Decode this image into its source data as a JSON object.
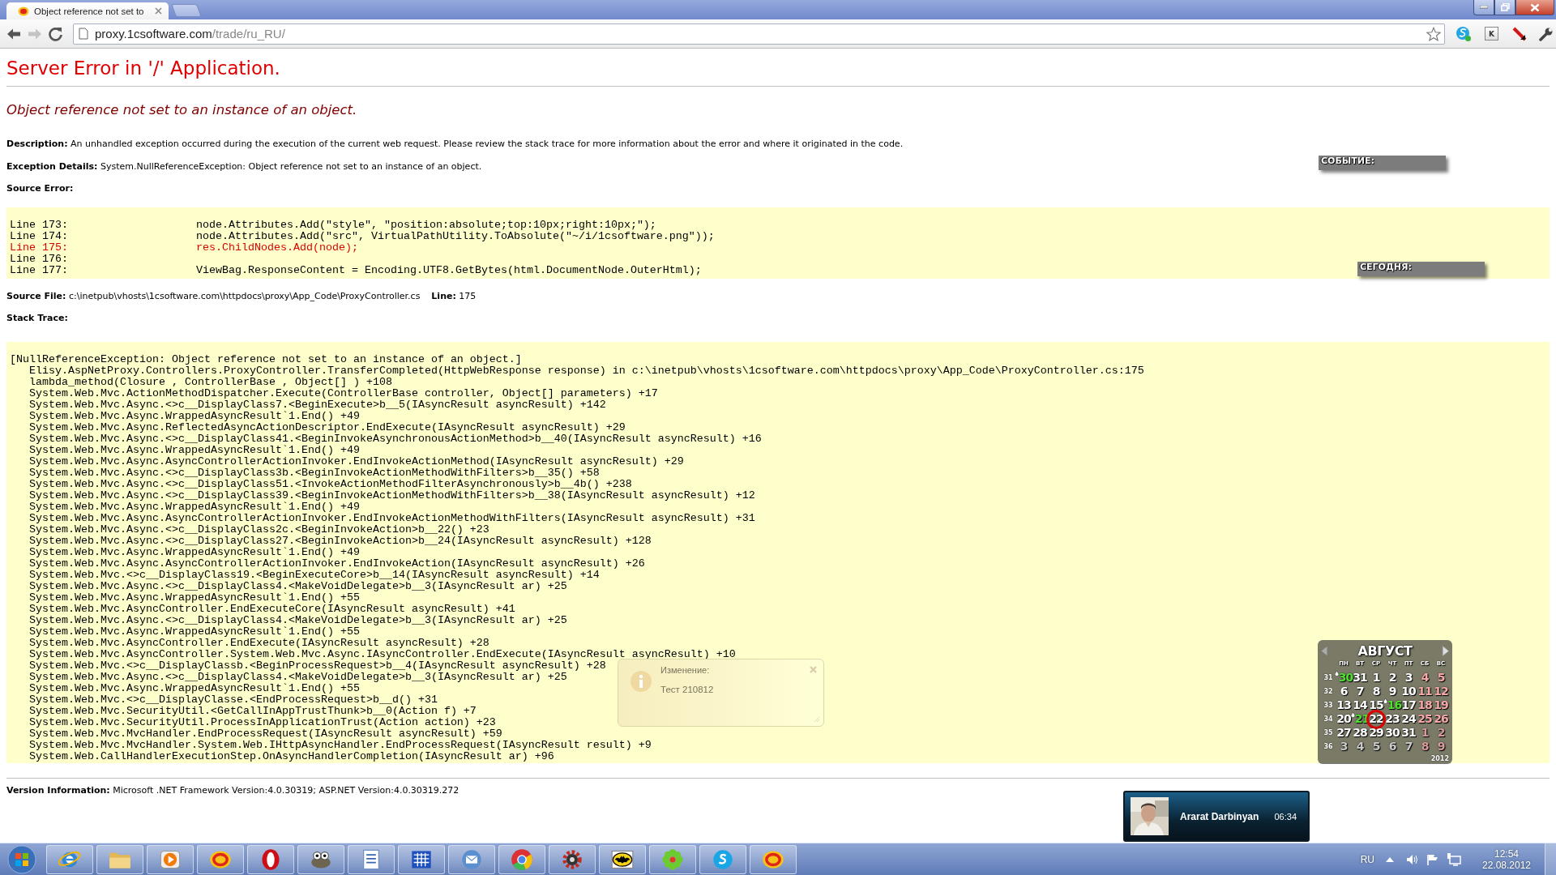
{
  "browser": {
    "tab": {
      "title": "Object reference not set to",
      "selected": true
    },
    "url": {
      "host": "proxy.1csoftware.com",
      "path": "/trade/ru_RU/"
    },
    "extension_key_label": "K"
  },
  "page": {
    "title": "Server Error in '/' Application.",
    "message": "Object reference not set to an instance of an object.",
    "description": {
      "label": "Description:",
      "text": "An unhandled exception occurred during the execution of the current web request. Please review the stack trace for more information about the error and where it originated in the code."
    },
    "exception_details": {
      "label": "Exception Details:",
      "text": "System.NullReferenceException: Object reference not set to an instance of an object."
    },
    "source_error_label": "Source Error:",
    "source_lines": [
      {
        "label": "Line 173:",
        "code": "node.Attributes.Add(\"style\", \"position:absolute;top:10px;right:10px;\");",
        "error": false
      },
      {
        "label": "Line 174:",
        "code": "node.Attributes.Add(\"src\", VirtualPathUtility.ToAbsolute(\"~/i/1csoftware.png\"));",
        "error": false
      },
      {
        "label": "Line 175:",
        "code": "res.ChildNodes.Add(node);",
        "error": true
      },
      {
        "label": "Line 176:",
        "error": false
      },
      {
        "label": "Line 177:",
        "code": "ViewBag.ResponseContent = Encoding.UTF8.GetBytes(html.DocumentNode.OuterHtml);",
        "error": false
      }
    ],
    "source_file": {
      "label": "Source File:",
      "path": "c:\\inetpub\\vhosts\\1csoftware.com\\httpdocs\\proxy\\App_Code\\ProxyController.cs",
      "line_label": "Line:",
      "line": "175"
    },
    "stack_trace_label": "Stack Trace:",
    "stack_trace": [
      "[NullReferenceException: Object reference not set to an instance of an object.]",
      "   Elisy.AspNetProxy.Controllers.ProxyController.TransferCompleted(HttpWebResponse response) in c:\\inetpub\\vhosts\\1csoftware.com\\httpdocs\\proxy\\App_Code\\ProxyController.cs:175",
      "   lambda_method(Closure , ControllerBase , Object[] ) +108",
      "   System.Web.Mvc.ActionMethodDispatcher.Execute(ControllerBase controller, Object[] parameters) +17",
      "   System.Web.Mvc.Async.<>c__DisplayClass7.<BeginExecute>b__5(IAsyncResult asyncResult) +142",
      "   System.Web.Mvc.Async.WrappedAsyncResult`1.End() +49",
      "   System.Web.Mvc.Async.ReflectedAsyncActionDescriptor.EndExecute(IAsyncResult asyncResult) +29",
      "   System.Web.Mvc.Async.<>c__DisplayClass41.<BeginInvokeAsynchronousActionMethod>b__40(IAsyncResult asyncResult) +16",
      "   System.Web.Mvc.Async.WrappedAsyncResult`1.End() +49",
      "   System.Web.Mvc.Async.AsyncControllerActionInvoker.EndInvokeActionMethod(IAsyncResult asyncResult) +29",
      "   System.Web.Mvc.Async.<>c__DisplayClass3b.<BeginInvokeActionMethodWithFilters>b__35() +58",
      "   System.Web.Mvc.Async.<>c__DisplayClass51.<InvokeActionMethodFilterAsynchronously>b__4b() +238",
      "   System.Web.Mvc.Async.<>c__DisplayClass39.<BeginInvokeActionMethodWithFilters>b__38(IAsyncResult asyncResult) +12",
      "   System.Web.Mvc.Async.WrappedAsyncResult`1.End() +49",
      "   System.Web.Mvc.Async.AsyncControllerActionInvoker.EndInvokeActionMethodWithFilters(IAsyncResult asyncResult) +31",
      "   System.Web.Mvc.Async.<>c__DisplayClass2c.<BeginInvokeAction>b__22() +23",
      "   System.Web.Mvc.Async.<>c__DisplayClass27.<BeginInvokeAction>b__24(IAsyncResult asyncResult) +128",
      "   System.Web.Mvc.Async.WrappedAsyncResult`1.End() +49",
      "   System.Web.Mvc.Async.AsyncControllerActionInvoker.EndInvokeAction(IAsyncResult asyncResult) +26",
      "   System.Web.Mvc.<>c__DisplayClass19.<BeginExecuteCore>b__14(IAsyncResult asyncResult) +14",
      "   System.Web.Mvc.Async.<>c__DisplayClass4.<MakeVoidDelegate>b__3(IAsyncResult ar) +25",
      "   System.Web.Mvc.Async.WrappedAsyncResult`1.End() +55",
      "   System.Web.Mvc.AsyncController.EndExecuteCore(IAsyncResult asyncResult) +41",
      "   System.Web.Mvc.Async.<>c__DisplayClass4.<MakeVoidDelegate>b__3(IAsyncResult ar) +25",
      "   System.Web.Mvc.Async.WrappedAsyncResult`1.End() +55",
      "   System.Web.Mvc.AsyncController.EndExecute(IAsyncResult asyncResult) +28",
      "   System.Web.Mvc.AsyncController.System.Web.Mvc.Async.IAsyncController.EndExecute(IAsyncResult asyncResult) +10",
      "   System.Web.Mvc.<>c__DisplayClassb.<BeginProcessRequest>b__4(IAsyncResult asyncResult) +28",
      "   System.Web.Mvc.Async.<>c__DisplayClass4.<MakeVoidDelegate>b__3(IAsyncResult ar) +25",
      "   System.Web.Mvc.Async.WrappedAsyncResult`1.End() +55",
      "   System.Web.Mvc.<>c__DisplayClasse.<EndProcessRequest>b__d() +31",
      "   System.Web.Mvc.SecurityUtil.<GetCallInAppTrustThunk>b__0(Action f) +7",
      "   System.Web.Mvc.SecurityUtil.ProcessInApplicationTrust(Action action) +23",
      "   System.Web.Mvc.MvcHandler.EndProcessRequest(IAsyncResult asyncResult) +59",
      "   System.Web.Mvc.MvcHandler.System.Web.IHttpAsyncHandler.EndProcessRequest(IAsyncResult result) +9",
      "   System.Web.CallHandlerExecutionStep.OnAsyncHandlerCompletion(IAsyncResult ar) +96"
    ],
    "version": {
      "label": "Version Information:",
      "text": "Microsoft .NET Framework Version:4.0.30319; ASP.NET Version:4.0.30319.272"
    }
  },
  "gadgets": {
    "event_label": "СОБЫТИЕ:",
    "today_label": "СЕГОДНЯ:",
    "calendar": {
      "month": "АВГУСТ",
      "year": "2012",
      "weekdays": [
        "ПН",
        "ВТ",
        "СР",
        "ЧТ",
        "ПТ",
        "СБ",
        "ВС"
      ],
      "weeks": [
        {
          "number": "31",
          "days": [
            {
              "day": "30",
              "kind": "event",
              "today": false
            },
            {
              "day": "31",
              "kind": "weekday",
              "today": false
            },
            {
              "day": "1",
              "kind": "weekday",
              "today": false
            },
            {
              "day": "2",
              "kind": "weekday",
              "today": false
            },
            {
              "day": "3",
              "kind": "weekday",
              "today": false
            },
            {
              "day": "4",
              "kind": "weekend",
              "today": false
            },
            {
              "day": "5",
              "kind": "weekend",
              "today": false
            }
          ]
        },
        {
          "number": "32",
          "days": [
            {
              "day": "6",
              "kind": "weekday",
              "today": false
            },
            {
              "day": "7",
              "kind": "weekday",
              "today": false
            },
            {
              "day": "8",
              "kind": "weekday",
              "today": false
            },
            {
              "day": "9",
              "kind": "weekday",
              "today": false
            },
            {
              "day": "10",
              "kind": "weekday",
              "today": false
            },
            {
              "day": "11",
              "kind": "weekend",
              "today": false
            },
            {
              "day": "12",
              "kind": "weekend",
              "today": false
            }
          ]
        },
        {
          "number": "33",
          "days": [
            {
              "day": "13",
              "kind": "weekday",
              "today": false
            },
            {
              "day": "14",
              "kind": "weekday",
              "today": false
            },
            {
              "day": "15",
              "kind": "weekday",
              "today": false
            },
            {
              "day": "16",
              "kind": "event",
              "today": false
            },
            {
              "day": "17",
              "kind": "weekday",
              "today": false
            },
            {
              "day": "18",
              "kind": "weekend",
              "today": false
            },
            {
              "day": "19",
              "kind": "weekend",
              "today": false
            }
          ]
        },
        {
          "number": "34",
          "days": [
            {
              "day": "20",
              "kind": "weekday",
              "today": false
            },
            {
              "day": "21",
              "kind": "event",
              "today": false
            },
            {
              "day": "22",
              "kind": "weekday",
              "today": true
            },
            {
              "day": "23",
              "kind": "weekday",
              "today": false
            },
            {
              "day": "24",
              "kind": "weekday",
              "today": false
            },
            {
              "day": "25",
              "kind": "weekend",
              "today": false
            },
            {
              "day": "26",
              "kind": "weekend",
              "today": false
            }
          ]
        },
        {
          "number": "35",
          "days": [
            {
              "day": "27",
              "kind": "weekday",
              "today": false
            },
            {
              "day": "28",
              "kind": "weekday",
              "today": false
            },
            {
              "day": "29",
              "kind": "weekday",
              "today": false
            },
            {
              "day": "30",
              "kind": "weekday",
              "today": false
            },
            {
              "day": "31",
              "kind": "weekday",
              "today": false
            },
            {
              "day": "1",
              "kind": "outside_weekend",
              "today": false
            },
            {
              "day": "2",
              "kind": "outside_weekend",
              "today": false
            }
          ]
        },
        {
          "number": "36",
          "days": [
            {
              "day": "3",
              "kind": "outside",
              "today": false
            },
            {
              "day": "4",
              "kind": "outside",
              "today": false
            },
            {
              "day": "5",
              "kind": "outside",
              "today": false
            },
            {
              "day": "6",
              "kind": "outside",
              "today": false
            },
            {
              "day": "7",
              "kind": "outside",
              "today": false
            },
            {
              "day": "8",
              "kind": "outside_weekend",
              "today": false
            },
            {
              "day": "9",
              "kind": "outside_weekend",
              "today": false
            }
          ]
        }
      ]
    }
  },
  "notification": {
    "title": "Изменение:",
    "text": "Тест 210812"
  },
  "contact_toast": {
    "name": "Ararat Darbinyan",
    "time": "06:34"
  },
  "taskbar": {
    "language": "RU",
    "time": "12:54",
    "date": "22.08.2012"
  }
}
